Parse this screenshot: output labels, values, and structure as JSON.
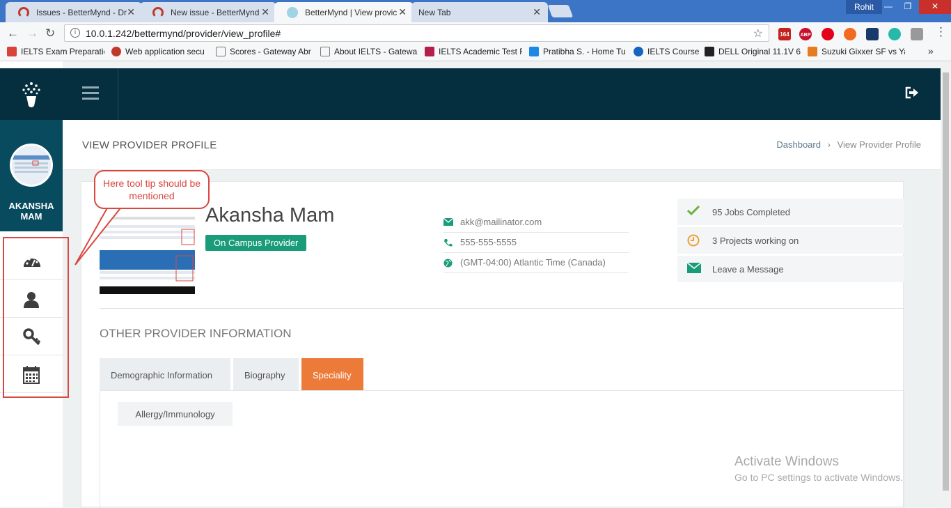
{
  "browser": {
    "tabs": [
      {
        "title": "Issues - BetterMynd - Dr",
        "active": false
      },
      {
        "title": "New issue - BetterMynd",
        "active": false
      },
      {
        "title": "BetterMynd | View provic",
        "active": true
      },
      {
        "title": "New Tab",
        "active": false
      }
    ],
    "profile_name": "Rohit",
    "url": "10.0.1.242/bettermynd/provider/view_profile#",
    "gmail_badge": "164",
    "abp_label": "ABP",
    "bookmarks": [
      "IELTS Exam Preparatic",
      "Web application secu",
      "Scores - Gateway Abr",
      "About IELTS - Gatewa",
      "IELTS Academic Test F",
      "Pratibha S. - Home Tu",
      "IELTS Course",
      "DELL Original 11.1V 6",
      "Suzuki Gixxer SF vs Ya"
    ],
    "bookmarks_more": "»"
  },
  "sidebar": {
    "user_name": "AKANSHA MAM",
    "items": [
      "dashboard",
      "profile",
      "password",
      "calendar"
    ]
  },
  "page": {
    "title": "VIEW PROVIDER PROFILE",
    "breadcrumb": {
      "root": "Dashboard",
      "separator": "›",
      "current": "View Provider Profile"
    }
  },
  "profile": {
    "name": "Akansha Mam",
    "badge": "On Campus Provider",
    "email": "akk@mailinator.com",
    "phone": "555-555-5555",
    "timezone": "(GMT-04:00) Atlantic Time (Canada)"
  },
  "stats": {
    "jobs": "95 Jobs Completed",
    "projects": "3 Projects working on",
    "message": "Leave a Message"
  },
  "other": {
    "title": "OTHER PROVIDER INFORMATION",
    "tabs": [
      "Demographic Information",
      "Biography",
      "Speciality"
    ],
    "active_tab": "Speciality",
    "specialities": [
      "Allergy/Immunology"
    ]
  },
  "annotation": {
    "callout": "Here tool tip should be mentioned"
  },
  "watermark": {
    "line1": "Activate Windows",
    "line2": "Go to PC settings to activate Windows."
  },
  "colors": {
    "topbar": "#052e3e",
    "sidebar_user": "#084b5e",
    "badge": "#1a9c7a",
    "active_tab": "#ec7b3a",
    "annotation": "#d9473f"
  }
}
